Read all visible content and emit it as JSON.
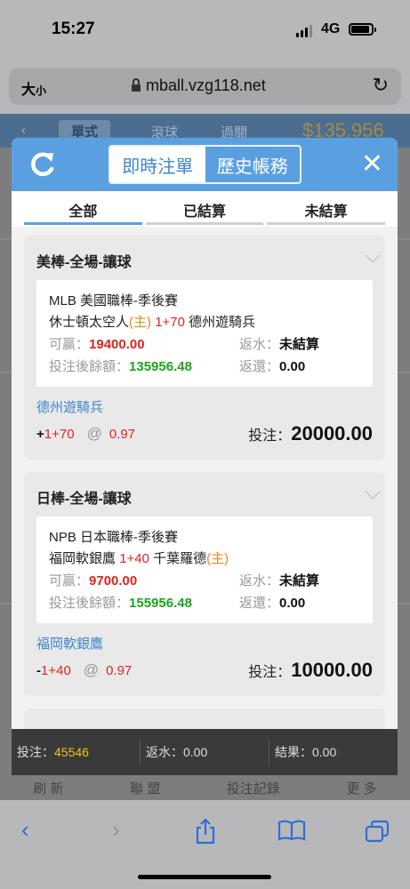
{
  "status": {
    "time": "15:27",
    "network": "4G"
  },
  "browser": {
    "text_size_label": "大",
    "text_size_small": "小",
    "url": "mball.vzg118.net"
  },
  "background": {
    "tab_single": "單式",
    "tab_rolling": "滾球",
    "tab_parlay": "過關",
    "balance": "$135,956"
  },
  "modal": {
    "tabs": [
      "即時注單",
      "歷史帳務"
    ],
    "filters": [
      "全部",
      "已結算",
      "未結算"
    ],
    "bets": [
      {
        "category": "美棒-全場-讓球",
        "league": "MLB 美國職棒-季後賽",
        "home": "休士頓太空人",
        "home_tag": "(主)",
        "line": "1+70",
        "away": "德州遊騎兵",
        "away_tag": "",
        "win_label": "可贏：",
        "win_value": "19400.00",
        "rebate_label": "返水：",
        "rebate_value": "未結算",
        "balance_label": "投注後餘額：",
        "balance_value": "135956.48",
        "refund_label": "返還：",
        "refund_value": "0.00",
        "pick": "德州遊騎兵",
        "pick_sign": "+",
        "pick_line": "1+70",
        "at": "@",
        "odds": "0.97",
        "stake_label": "投注：",
        "stake": "20000.00"
      },
      {
        "category": "日棒-全場-讓球",
        "league": "NPB 日本職棒-季後賽",
        "home": "福岡軟銀鷹",
        "home_tag": "",
        "line": "1+40",
        "away": "千葉羅德",
        "away_tag": "(主)",
        "win_label": "可贏：",
        "win_value": "9700.00",
        "rebate_label": "返水：",
        "rebate_value": "未結算",
        "balance_label": "投注後餘額：",
        "balance_value": "155956.48",
        "refund_label": "返還：",
        "refund_value": "0.00",
        "pick": "福岡軟銀鷹",
        "pick_sign": "-",
        "pick_line": "1+40",
        "at": "@",
        "odds": "0.97",
        "stake_label": "投注：",
        "stake": "10000.00"
      }
    ],
    "summary": {
      "bet_label": "投注：",
      "bet_value": "45546",
      "rebate_label": "返水：",
      "rebate_value": "0.00",
      "result_label": "結果：",
      "result_value": "0.00"
    }
  },
  "bottom_nav": [
    "刷 新",
    "聯 盟",
    "投注記錄",
    "更 多"
  ],
  "colors": {
    "accent": "#5aa0e1",
    "red": "#e0241e",
    "green": "#1ca51c",
    "orange": "#e48a1a"
  }
}
